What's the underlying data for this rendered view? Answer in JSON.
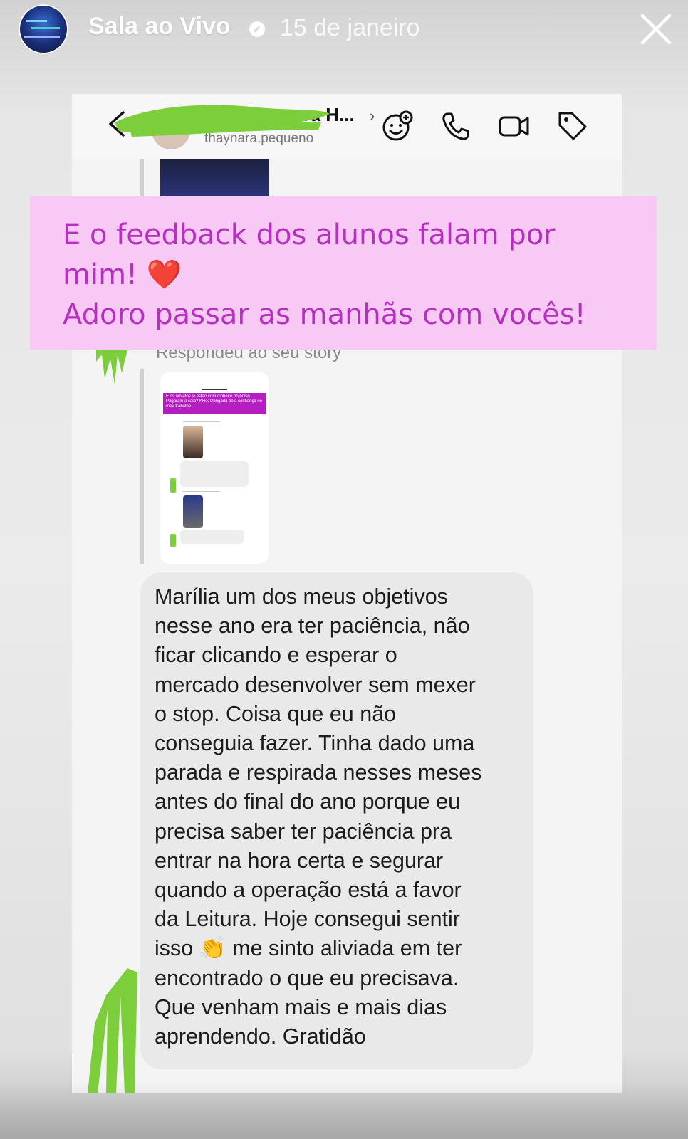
{
  "story": {
    "account_name": "Sala ao Vivo",
    "date": "15 de janeiro",
    "verified_icon": "verified-badge-icon",
    "close_icon": "close-icon"
  },
  "chat_header": {
    "contact_name_fragment": "ara H...",
    "contact_username": "thaynara.pequeno",
    "icons": [
      "back-icon",
      "sticker-icon",
      "phone-icon",
      "video-icon",
      "tag-icon"
    ]
  },
  "caption": {
    "line1": "E o feedback dos alunos falam por",
    "line2": "mim! ",
    "heart": "❤️",
    "line3": "Adoro passar as manhãs com vocês!",
    "color": "#b62fc0",
    "background": "#f9c9f6"
  },
  "thread": {
    "replied_label": "Respondeu ao seu story",
    "preview": {
      "banner_text": "E os novatos já estão com dinheiro no bolso. Pagaram a sala? Kkkk Obrigada pela confiança no meu trabalho",
      "replied_label_small": "Respondeu ao seu story",
      "msg1": "Primeiro dia hj. Muito top Marília. Pelo que foi hoje, deu para perceber que era o q estava procurando. Obrigado!",
      "replied_label_small2": "Respondeu ao seu story",
      "msg2": "Muito top a condução feita por você!!"
    },
    "message": "Marília um dos meus objetivos\nnesse ano era ter paciência, não\nficar clicando e esperar o\nmercado desenvolver sem mexer\no stop. Coisa que eu não\nconseguia fazer. Tinha dado uma\nparada e respirada nesses meses\nantes do final do ano porque eu\nprecisa saber ter paciência pra\nentrar na hora certa e segurar\nquando a operação está a favor\nda Leitura. Hoje consegui sentir\nisso 👏 me sinto aliviada em ter\nencontrado o que eu  precisava.\nQue venham mais e mais dias\naprendendo. Gratidão"
  },
  "colors": {
    "scribble_green": "#7ccf3a",
    "bubble_bg": "#e9e9e9"
  }
}
